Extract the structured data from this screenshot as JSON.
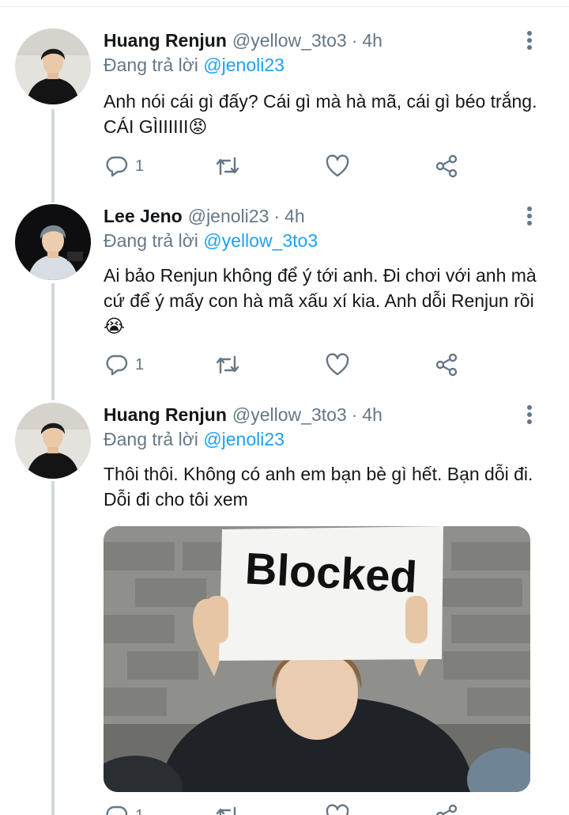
{
  "tweets": [
    {
      "name": "Huang Renjun",
      "handle": "@yellow_3to3",
      "dot": "·",
      "time": "4h",
      "reply_prefix": "Đang trả lời",
      "reply_to": "@jenoli23",
      "text": "Anh nói cái gì đấy? Cái gì mà hà mã, cái gì béo trắng. CÁI GÌIIIIII😡",
      "replies": "1",
      "avatar_icon": "profile-photo"
    },
    {
      "name": "Lee Jeno",
      "handle": "@jenoli23",
      "dot": "·",
      "time": "4h",
      "reply_prefix": "Đang trả lời",
      "reply_to": "@yellow_3to3",
      "text": "Ai bảo Renjun không để ý tới anh. Đi chơi với anh mà cứ để ý mấy con hà mã xấu xí kia. Anh dỗi Renjun rồi😭",
      "replies": "1",
      "avatar_icon": "profile-photo"
    },
    {
      "name": "Huang Renjun",
      "handle": "@yellow_3to3",
      "dot": "·",
      "time": "4h",
      "reply_prefix": "Đang trả lời",
      "reply_to": "@jenoli23",
      "text": "Thôi thôi. Không có anh em bạn bè gì hết. Bạn dỗi đi. Dỗi đi cho tôi xem",
      "replies": "1",
      "media_sign_text": "Blocked",
      "avatar_icon": "profile-photo"
    }
  ],
  "icons": [
    "reply-icon",
    "retweet-icon",
    "like-icon",
    "share-icon",
    "more-options-icon"
  ],
  "colors": {
    "link": "#1da1f2",
    "secondary_text": "#657786",
    "primary_text": "#14171a",
    "thread_line": "#cfd9de"
  }
}
